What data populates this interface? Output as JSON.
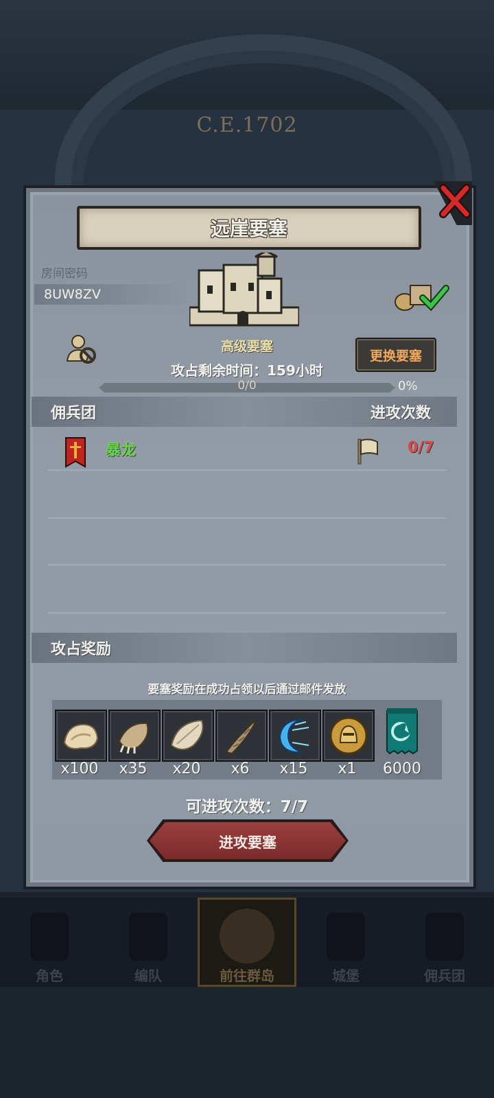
{
  "background": {
    "era_label": "C.E.1702"
  },
  "dialog": {
    "title": "远崖要塞",
    "room_code_label": "房间密码",
    "room_code": "8UW8ZV",
    "fortress_level": "高级要塞",
    "change_button": "更换要塞",
    "time_remaining": "攻占剩余时间：159小时",
    "progress": {
      "text": "0/0",
      "percent_label": "0%",
      "fraction": 0
    },
    "section_mercenary": "佣兵团",
    "section_attacks": "进攻次数",
    "mercenary_rows": [
      {
        "name": "暴龙",
        "attacks": "0/7"
      }
    ],
    "section_rewards": "攻占奖励",
    "reward_note": "要塞奖励在成功占领以后通过邮件发放",
    "rewards": [
      {
        "icon": "fur-pelt-icon",
        "qty": "x100"
      },
      {
        "icon": "claw-hide-icon",
        "qty": "x35"
      },
      {
        "icon": "feather-pelt-icon",
        "qty": "x20"
      },
      {
        "icon": "horn-icon",
        "qty": "x6"
      },
      {
        "icon": "blue-crescent-icon",
        "qty": "x15"
      },
      {
        "icon": "golden-helmet-medal-icon",
        "qty": "x1"
      },
      {
        "icon": "guild-banner-icon",
        "qty": "6000"
      }
    ],
    "attempts_label": "可进攻次数：7/7",
    "attack_button": "进攻要塞"
  },
  "bottom_nav": [
    {
      "label": "角色",
      "active": false
    },
    {
      "label": "编队",
      "active": false
    },
    {
      "label": "前往群岛",
      "active": true
    },
    {
      "label": "城堡",
      "active": false
    },
    {
      "label": "佣兵团",
      "active": false
    }
  ],
  "colors": {
    "merc_name": "#6bd24e",
    "attack_count": "#d84b4b",
    "change_button_text": "#f3a75b",
    "attack_button": "#8b3434"
  }
}
